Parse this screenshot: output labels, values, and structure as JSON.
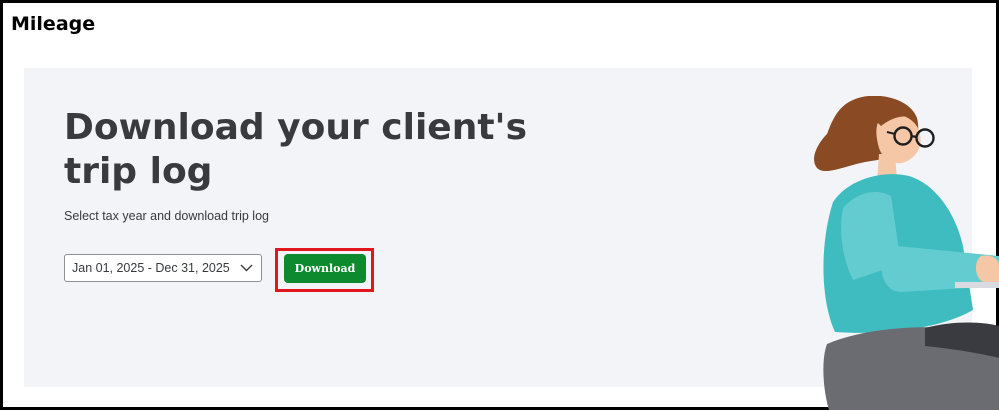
{
  "page": {
    "title": "Mileage"
  },
  "download_card": {
    "heading": "Download your client's trip log",
    "subtitle": "Select tax year and download trip log",
    "date_range_select": {
      "value": "Jan 01, 2025 - Dec 31, 2025",
      "icon": "chevron-down-icon"
    },
    "download_button_label": "Download",
    "highlight_color": "#e2161d"
  },
  "colors": {
    "card_background": "#f3f4f7",
    "primary_button": "#0d8a2e",
    "heading_text": "#393a3d"
  }
}
